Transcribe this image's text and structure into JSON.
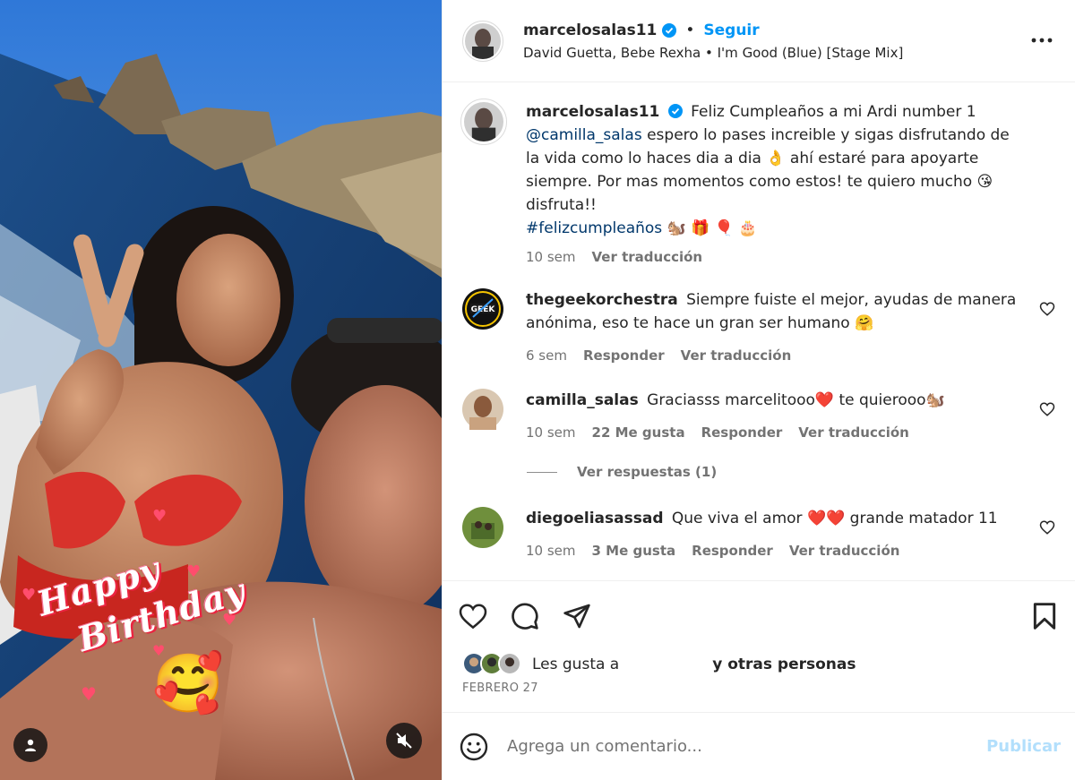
{
  "header": {
    "username": "marcelosalas11",
    "separator": "•",
    "follow_label": "Seguir",
    "audio": "David Guetta, Bebe Rexha • I'm Good (Blue) [Stage Mix]",
    "more_icon": "more-horizontal-icon"
  },
  "media": {
    "sticker_line1": "Happy",
    "sticker_line2": "Birthday",
    "sticker_emoji": "🥰",
    "user_tag_icon": "person-icon",
    "mute_icon": "audio-muted-icon"
  },
  "caption": {
    "username": "marcelosalas11",
    "text_1": "Feliz Cumpleaños a mi Ardi number 1",
    "mention": "@camilla_salas",
    "text_2": " espero lo pases increible y sigas disfrutando de la vida como lo haces dia a dia 👌 ahí estaré para apoyarte siempre. Por mas momentos como estos! te quiero mucho 😘 disfruta!!",
    "hashtag": "#felizcumpleaños",
    "emojis": " 🐿️ 🎁 🎈 🎂",
    "time": "10 sem",
    "translate": "Ver traducción"
  },
  "comments": [
    {
      "username": "thegeekorchestra",
      "text": "Siempre fuiste el mejor, ayudas de manera anónima, eso te hace un gran ser humano 🤗",
      "time": "6 sem",
      "reply": "Responder",
      "translate": "Ver traducción",
      "avatar_label": "GEEK"
    },
    {
      "username": "camilla_salas",
      "text": "Graciasss marcelitooo❤️ te quierooo🐿️",
      "time": "10 sem",
      "likes": "22 Me gusta",
      "reply": "Responder",
      "translate": "Ver traducción",
      "view_replies": "Ver respuestas (1)"
    },
    {
      "username": "diegoeliasassad",
      "text": "Que viva el amor ❤️❤️ grande matador 11",
      "time": "10 sem",
      "likes": "3 Me gusta",
      "reply": "Responder",
      "translate": "Ver traducción"
    }
  ],
  "actions": {
    "like_icon": "heart-icon",
    "comment_icon": "comment-icon",
    "share_icon": "share-icon",
    "save_icon": "bookmark-icon"
  },
  "likes": {
    "prefix": "Les gusta a",
    "suffix": "y otras personas"
  },
  "date": "FEBRERO 27",
  "composer": {
    "placeholder": "Agrega un comentario...",
    "post_label": "Publicar",
    "emoji_icon": "smiley-icon"
  },
  "colors": {
    "accent": "#0095f6",
    "post_disabled": "#b2dffc",
    "muted_text": "#737373",
    "heart_red": "#ed4956"
  }
}
